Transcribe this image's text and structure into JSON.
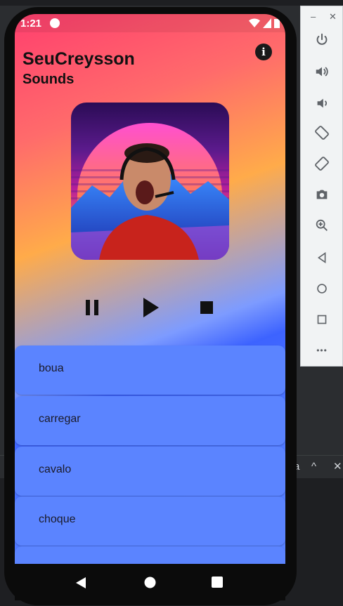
{
  "status_bar": {
    "time": "1:21"
  },
  "app": {
    "title_line1": "SeuCreysson",
    "title_line2": "Sounds",
    "info_glyph": "i"
  },
  "controls": {
    "pause_icon": "pause-icon",
    "play_icon": "play-icon",
    "stop_icon": "stop-icon"
  },
  "sounds": [
    {
      "label": "boua"
    },
    {
      "label": "carregar"
    },
    {
      "label": "cavalo"
    },
    {
      "label": "choque"
    },
    {
      "label": ""
    }
  ],
  "ide": {
    "bottom_glyph": "a",
    "up_glyph": "^",
    "close_glyph": "✕"
  },
  "emulator_toolbar": {
    "minimize_glyph": "–",
    "close_glyph": "✕",
    "more_glyph": "•••"
  },
  "colors": {
    "list_item": "#5b84ff",
    "gradient_top": "#ff3f6e",
    "gradient_mid": "#ffab4a",
    "gradient_bottom": "#3d63ff"
  }
}
